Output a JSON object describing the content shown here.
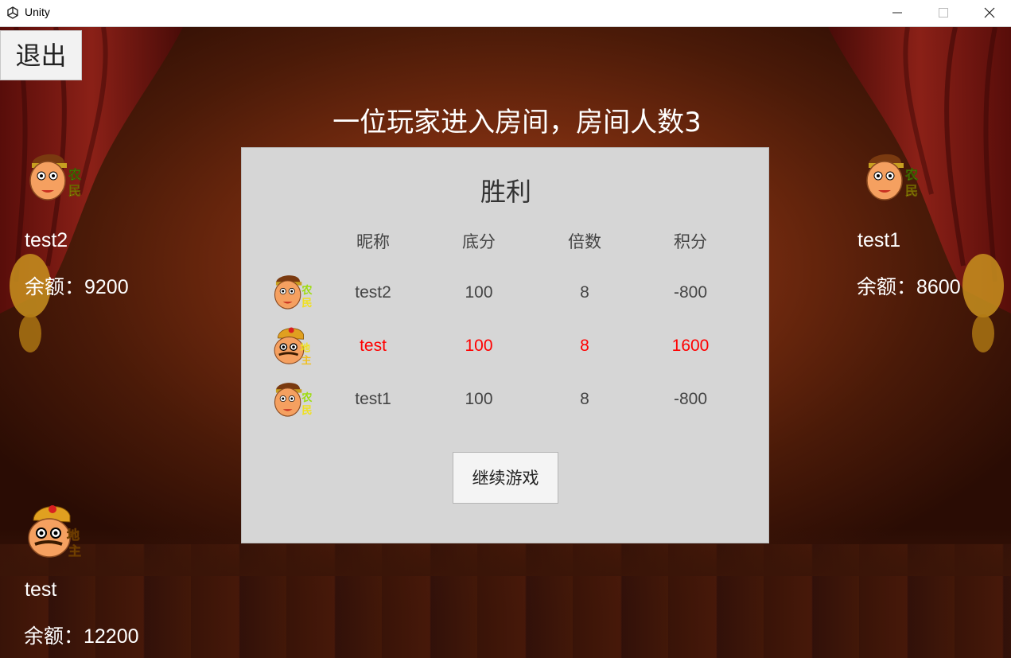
{
  "window": {
    "title": "Unity",
    "app_icon": "unity-logo-icon",
    "controls": [
      "minimize-icon",
      "maximize-icon",
      "close-icon"
    ]
  },
  "exit_button": {
    "label": "退出"
  },
  "room_message": "一位玩家进入房间，房间人数3",
  "players": {
    "left": {
      "name": "test2",
      "balance_label": "余额：9200",
      "role": "农民"
    },
    "right": {
      "name": "test1",
      "balance_label": "余额：8600",
      "role": "农民"
    },
    "self": {
      "name": "test",
      "balance_label": "余额：12200",
      "role": "地主"
    }
  },
  "result_panel": {
    "title": "胜利",
    "headers": [
      "昵称",
      "底分",
      "倍数",
      "积分"
    ],
    "rows": [
      {
        "role": "农民",
        "name": "test2",
        "base": "100",
        "multiplier": "8",
        "score": "-800",
        "highlight": false
      },
      {
        "role": "地主",
        "name": "test",
        "base": "100",
        "multiplier": "8",
        "score": "1600",
        "highlight": true
      },
      {
        "role": "农民",
        "name": "test1",
        "base": "100",
        "multiplier": "8",
        "score": "-800",
        "highlight": false
      }
    ],
    "continue_label": "继续游戏"
  },
  "colors": {
    "highlight": "#ff0000",
    "normal_text": "#444444",
    "panel_bg": "#d6d6d6"
  }
}
